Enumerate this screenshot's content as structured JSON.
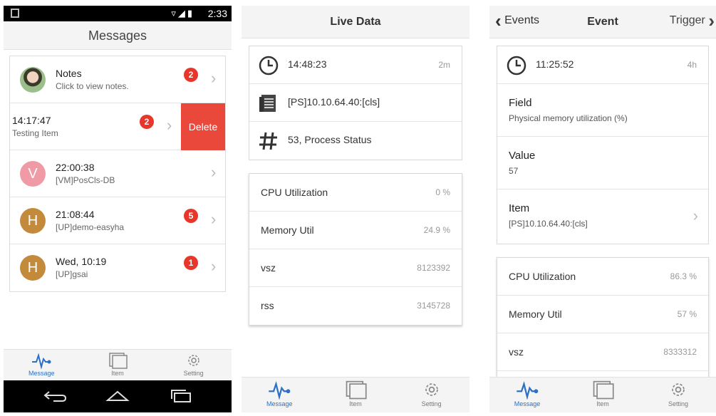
{
  "screen1": {
    "status": {
      "time": "2:33"
    },
    "header_title": "Messages",
    "messages": [
      {
        "title": "Notes",
        "subtitle": "Click to view notes.",
        "badge": "2"
      },
      {
        "title": "14:17:47",
        "subtitle": "Testing Item",
        "badge": "2",
        "action": "Delete"
      },
      {
        "title": "22:00:38",
        "subtitle": "[VM]PosCls-DB",
        "avatar_letter": "V",
        "avatar_color": "#ef9aa5"
      },
      {
        "title": "21:08:44",
        "subtitle": "[UP]demo-easyha",
        "avatar_letter": "H",
        "avatar_color": "#c48a3c",
        "badge": "5"
      },
      {
        "title": "Wed, 10:19",
        "subtitle": "[UP]gsai",
        "avatar_letter": "H",
        "avatar_color": "#c48a3c",
        "badge": "1"
      }
    ],
    "tabs": [
      "Message",
      "Item",
      "Setting"
    ]
  },
  "screen2": {
    "header_title": "Live Data",
    "info": [
      {
        "icon": "clock-icon",
        "text": "14:48:23",
        "right": "2m"
      },
      {
        "icon": "document-icon",
        "text": "[PS]10.10.64.40:[cls]"
      },
      {
        "icon": "hash-icon",
        "text": "53, Process Status"
      }
    ],
    "metrics": [
      {
        "label": "CPU Utilization",
        "value": "0 %"
      },
      {
        "label": "Memory Util",
        "value": "24.9 %"
      },
      {
        "label": "vsz",
        "value": "8123392"
      },
      {
        "label": "rss",
        "value": "3145728"
      }
    ],
    "tabs": [
      "Message",
      "Item",
      "Setting"
    ]
  },
  "screen3": {
    "back_label": "Events",
    "header_title": "Event",
    "forward_label": "Trigger",
    "time": {
      "text": "11:25:52",
      "right": "4h"
    },
    "fields": [
      {
        "label": "Field",
        "value": "Physical memory utilization (%)"
      },
      {
        "label": "Value",
        "value": "57"
      },
      {
        "label": "Item",
        "value": "[PS]10.10.64.40:[cls]"
      }
    ],
    "metrics": [
      {
        "label": "CPU Utilization",
        "value": "86.3 %"
      },
      {
        "label": "Memory Util",
        "value": "57 %"
      },
      {
        "label": "vsz",
        "value": "8333312"
      }
    ],
    "tabs": [
      "Message",
      "Item",
      "Setting"
    ]
  },
  "colors": {
    "badge": "#e8362a",
    "delete": "#e9483b",
    "active_tab": "#2f6fc4",
    "bar_bg": "#f4f4f4"
  }
}
